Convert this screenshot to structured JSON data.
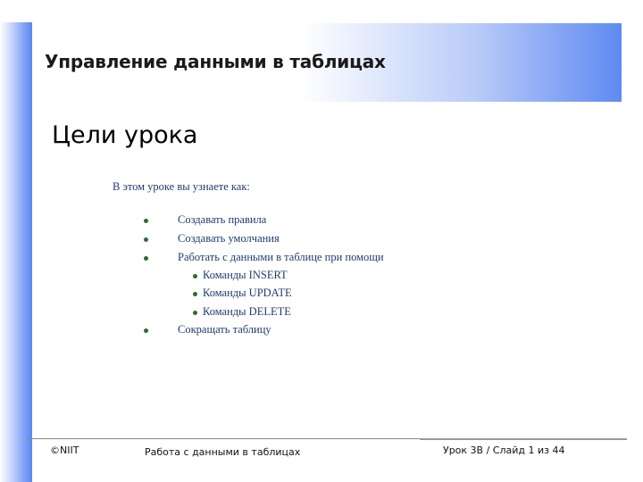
{
  "slide": {
    "title": "Управление данными в таблицах",
    "heading": "Цели урока",
    "intro": "В этом уроке вы узнаете как:",
    "bullets": [
      "Создавать правила",
      "Создавать умолчания",
      "Работать с данными в таблице при помощи",
      "Команды INSERT",
      "Команды UPDATE",
      "Команды DELETE",
      "Сокращать таблицу"
    ]
  },
  "footer": {
    "copyright": "©NIIT",
    "course": "Работа с данными в таблицах",
    "slide_info": "Урок 3В / Слайд 1 из 44"
  },
  "colors": {
    "accent_blue": "#5c85f0",
    "body_text": "#1f3b6e",
    "bullet": "#2a6b32"
  }
}
